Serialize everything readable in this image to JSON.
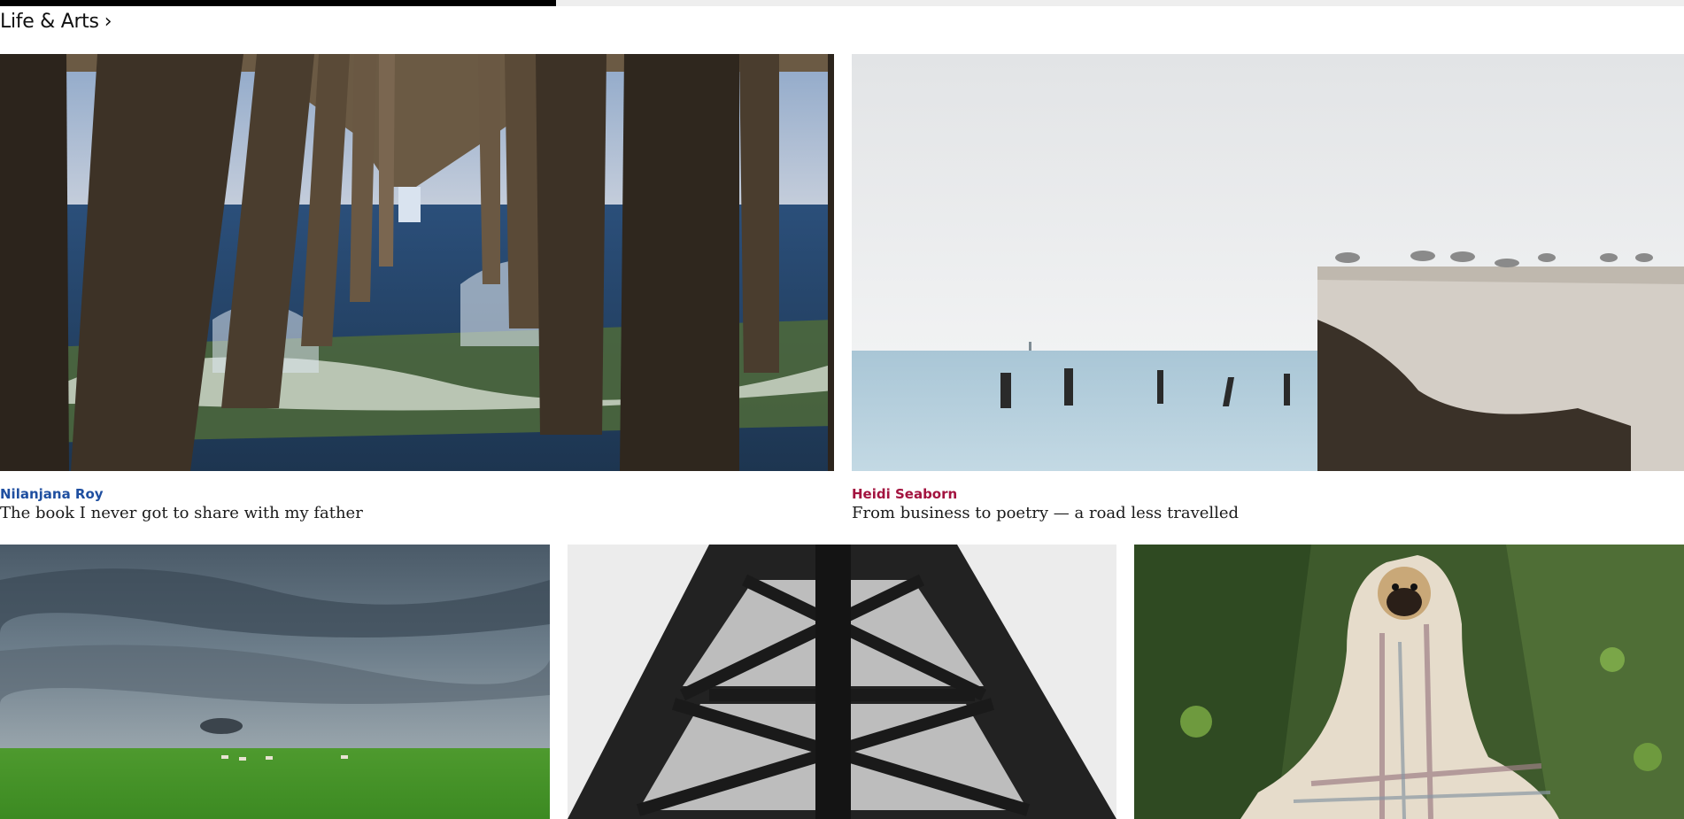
{
  "reading_progress": {
    "fraction": 0.33
  },
  "section": {
    "title": "Life & Arts",
    "chevron": "›"
  },
  "colors": {
    "author_blue": "#1f4fa0",
    "author_crimson": "#a3133f"
  },
  "articles": [
    {
      "author": "Nilanjana Roy",
      "title": "The book I never got to share with my father",
      "image": "pier-pilings-waves-photo",
      "author_color": "#1f4fa0"
    },
    {
      "author": "Heidi Seaborn",
      "title": "From business to poetry — a road less travelled",
      "image": "seagulls-on-concrete-pier-photo",
      "author_color": "#a3133f"
    },
    {
      "image": "stormy-sky-grassland-photo"
    },
    {
      "image": "steel-tower-lattice-photo"
    },
    {
      "image": "pug-in-blanket-photo"
    }
  ]
}
